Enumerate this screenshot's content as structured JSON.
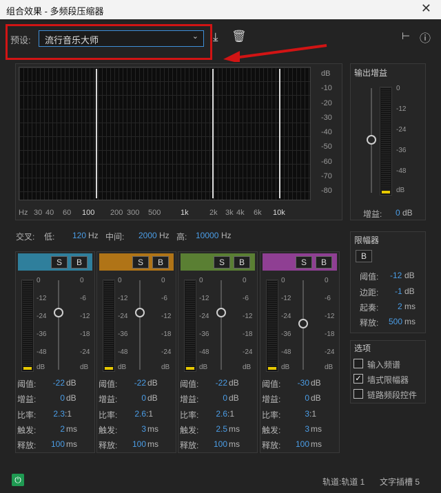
{
  "window": {
    "title": "组合效果 - 多频段压缩器",
    "close": "✕"
  },
  "preset": {
    "label": "预设:",
    "value": "流行音乐大师"
  },
  "graph": {
    "db_scale": [
      "dB",
      "-10",
      "-20",
      "-30",
      "-40",
      "-50",
      "-60",
      "-70",
      "-80"
    ],
    "freq_scale": [
      "Hz",
      "30",
      "40",
      "60",
      "100",
      "200",
      "300",
      "500",
      "1k",
      "2k",
      "3k",
      "4k",
      "6k",
      "10k"
    ]
  },
  "crossover": {
    "label": "交叉:",
    "low_label": "低:",
    "low_value": "120",
    "mid_label": "中间:",
    "mid_value": "2000",
    "high_label": "高:",
    "high_value": "10000",
    "unit": "Hz"
  },
  "bands": [
    {
      "color": "#2f7f9c",
      "threshold": "-22",
      "gain": "0",
      "ratio": "2.3",
      "attack": "2",
      "release": "100"
    },
    {
      "color": "#b07417",
      "threshold": "-22",
      "gain": "0",
      "ratio": "2.6",
      "attack": "3",
      "release": "100"
    },
    {
      "color": "#5a7f33",
      "threshold": "-22",
      "gain": "0",
      "ratio": "2.6",
      "attack": "2.5",
      "release": "100"
    },
    {
      "color": "#8f3f93",
      "threshold": "-30",
      "gain": "0",
      "ratio": "3",
      "attack": "3",
      "release": "100"
    }
  ],
  "band_labels": {
    "solo": "S",
    "bypass": "B",
    "threshold": "阈值:",
    "gain": "增益:",
    "ratio": "比率:",
    "attack": "触发:",
    "release": "释放:",
    "db": "dB",
    "ms": "ms",
    "ratio_unit": ":1"
  },
  "meter_scale": [
    "0",
    "-12",
    "-24",
    "-36",
    "-48",
    "dB"
  ],
  "gain_scale": [
    "0",
    "-6",
    "-12",
    "-18",
    "-24",
    "dB"
  ],
  "output_gain": {
    "title": "输出增益",
    "scale": [
      "0",
      "-12",
      "-24",
      "-36",
      "-48",
      "dB"
    ],
    "label": "增益:",
    "value": "0",
    "unit": "dB"
  },
  "limiter": {
    "title": "限幅器",
    "bypass": "B",
    "threshold_label": "阈值:",
    "threshold": "-12",
    "margin_label": "边距:",
    "margin": "-1",
    "attack_label": "起奏:",
    "attack": "2",
    "release_label": "释放:",
    "release": "500",
    "db": "dB",
    "ms": "ms"
  },
  "options": {
    "title": "选项",
    "items": [
      {
        "label": "输入频谱",
        "checked": false
      },
      {
        "label": "墙式限幅器",
        "checked": true
      },
      {
        "label": "链路频段控件",
        "checked": false
      }
    ]
  },
  "status": {
    "track": "轨道:轨道 1",
    "insert": "文字插槽 5"
  }
}
